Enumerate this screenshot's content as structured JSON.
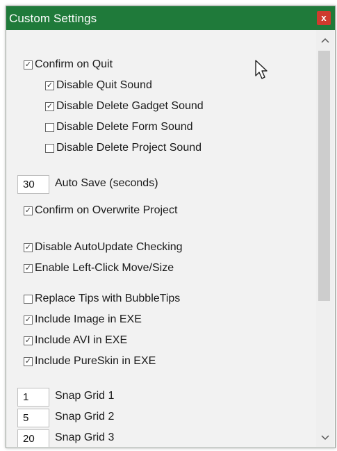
{
  "window": {
    "title": "Custom Settings",
    "close_label": "x"
  },
  "options": [
    {
      "label": "Confirm on Quit",
      "checked": true
    },
    {
      "label": "Disable Quit Sound",
      "checked": true
    },
    {
      "label": "Disable Delete Gadget Sound",
      "checked": true
    },
    {
      "label": "Disable Delete Form Sound",
      "checked": false
    },
    {
      "label": "Disable Delete Project Sound",
      "checked": false
    },
    {
      "label": "Confirm on Overwrite Project",
      "checked": true
    },
    {
      "label": "Disable AutoUpdate Checking",
      "checked": true
    },
    {
      "label": "Enable Left-Click Move/Size",
      "checked": true
    },
    {
      "label": "Replace Tips with BubbleTips",
      "checked": false
    },
    {
      "label": "Include Image in EXE",
      "checked": true
    },
    {
      "label": "Include AVI in EXE",
      "checked": true
    },
    {
      "label": "Include PureSkin in EXE",
      "checked": true
    }
  ],
  "autosave": {
    "value": "30",
    "label": "Auto Save (seconds)"
  },
  "snap": [
    {
      "value": "1",
      "label": "Snap Grid 1"
    },
    {
      "value": "5",
      "label": "Snap Grid 2"
    },
    {
      "value": "20",
      "label": "Snap Grid 3"
    }
  ],
  "scrollbar": {
    "up_icon": "chevron-up-icon",
    "down_icon": "chevron-down-icon"
  },
  "colors": {
    "titlebar": "#1f7a3a",
    "close": "#cf3b2e"
  }
}
